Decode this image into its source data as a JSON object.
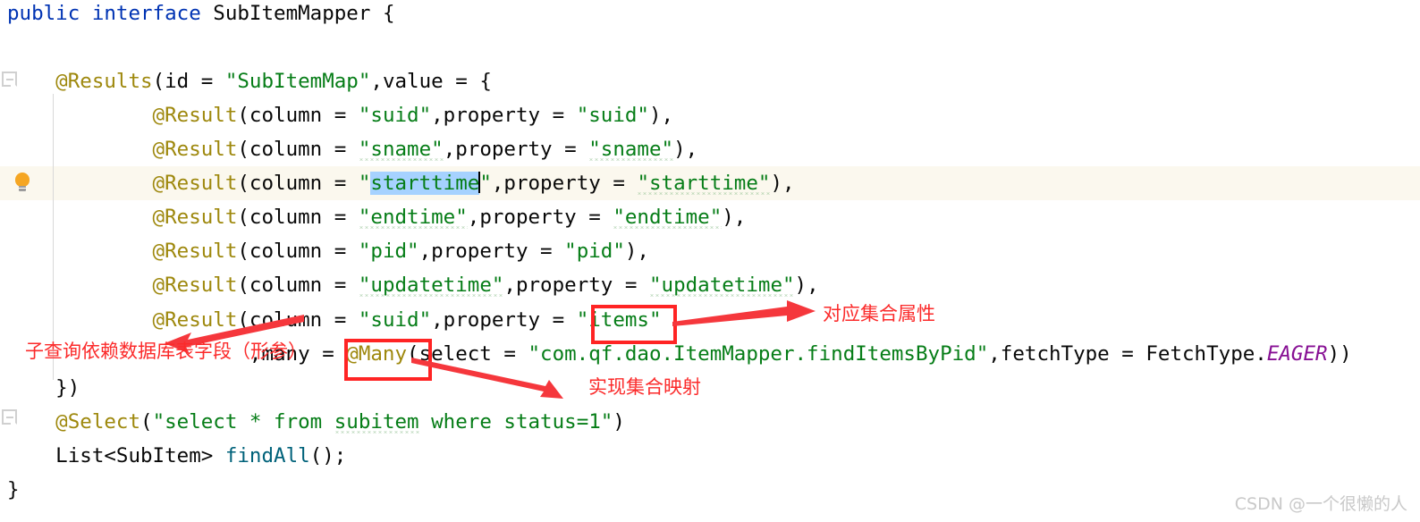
{
  "editor": {
    "language": "java",
    "background": "#ffffff",
    "current_line_highlight_color": "#fbf8ee",
    "selection_color": "#a6d2ff",
    "lines": [
      {
        "id": "line-1",
        "segments": [
          {
            "text": "public ",
            "kind": "keyword"
          },
          {
            "text": "interface ",
            "kind": "keyword"
          },
          {
            "text": "SubItemMapper {",
            "kind": "plain"
          }
        ]
      },
      {
        "id": "line-3",
        "segments": [
          {
            "text": "    @Results",
            "kind": "annotation"
          },
          {
            "text": "(id = ",
            "kind": "plain"
          },
          {
            "text": "\"SubItemMap\"",
            "kind": "string"
          },
          {
            "text": ",value = {",
            "kind": "plain"
          }
        ]
      },
      {
        "id": "line-4",
        "segments": [
          {
            "text": "            @Result",
            "kind": "annotation"
          },
          {
            "text": "(column = ",
            "kind": "plain"
          },
          {
            "text": "\"suid\"",
            "kind": "string"
          },
          {
            "text": ",property = ",
            "kind": "plain"
          },
          {
            "text": "\"suid\"",
            "kind": "string"
          },
          {
            "text": "),",
            "kind": "plain"
          }
        ]
      },
      {
        "id": "line-5",
        "segments": [
          {
            "text": "            @Result",
            "kind": "annotation"
          },
          {
            "text": "(column = ",
            "kind": "plain"
          },
          {
            "text": "\"sname\"",
            "kind": "string-squiggle"
          },
          {
            "text": ",property = ",
            "kind": "plain"
          },
          {
            "text": "\"sname\"",
            "kind": "string-squiggle"
          },
          {
            "text": "),",
            "kind": "plain"
          }
        ]
      },
      {
        "id": "line-6",
        "current": true,
        "segments": [
          {
            "text": "            @Result",
            "kind": "annotation"
          },
          {
            "text": "(column = ",
            "kind": "plain"
          },
          {
            "text": "\"",
            "kind": "string"
          },
          {
            "text": "starttime",
            "kind": "string-selected"
          },
          {
            "text": "\"",
            "kind": "string"
          },
          {
            "text": ",property = ",
            "kind": "plain"
          },
          {
            "text": "\"starttime\"",
            "kind": "string-squiggle"
          },
          {
            "text": "),",
            "kind": "plain"
          }
        ]
      },
      {
        "id": "line-7",
        "segments": [
          {
            "text": "            @Result",
            "kind": "annotation"
          },
          {
            "text": "(column = ",
            "kind": "plain"
          },
          {
            "text": "\"endtime\"",
            "kind": "string-squiggle"
          },
          {
            "text": ",property = ",
            "kind": "plain"
          },
          {
            "text": "\"endtime\"",
            "kind": "string-squiggle"
          },
          {
            "text": "),",
            "kind": "plain"
          }
        ]
      },
      {
        "id": "line-8",
        "segments": [
          {
            "text": "            @Result",
            "kind": "annotation"
          },
          {
            "text": "(column = ",
            "kind": "plain"
          },
          {
            "text": "\"pid\"",
            "kind": "string"
          },
          {
            "text": ",property = ",
            "kind": "plain"
          },
          {
            "text": "\"pid\"",
            "kind": "string"
          },
          {
            "text": "),",
            "kind": "plain"
          }
        ]
      },
      {
        "id": "line-9",
        "segments": [
          {
            "text": "            @Result",
            "kind": "annotation"
          },
          {
            "text": "(column = ",
            "kind": "plain"
          },
          {
            "text": "\"updatetime\"",
            "kind": "string-squiggle"
          },
          {
            "text": ",property = ",
            "kind": "plain"
          },
          {
            "text": "\"updatetime\"",
            "kind": "string-squiggle"
          },
          {
            "text": "),",
            "kind": "plain"
          }
        ]
      },
      {
        "id": "line-10",
        "segments": [
          {
            "text": "            @Result",
            "kind": "annotation"
          },
          {
            "text": "(column = ",
            "kind": "plain"
          },
          {
            "text": "\"suid\"",
            "kind": "string"
          },
          {
            "text": ",property = ",
            "kind": "plain"
          },
          {
            "text": "\"items\"",
            "kind": "string"
          }
        ]
      },
      {
        "id": "line-11",
        "segments": [
          {
            "text": "                    ,many = ",
            "kind": "plain"
          },
          {
            "text": "@Many",
            "kind": "annotation"
          },
          {
            "text": "(select = ",
            "kind": "plain"
          },
          {
            "text": "\"com.qf.dao.ItemMapper.findItemsByPid\"",
            "kind": "string"
          },
          {
            "text": ",fetchType = FetchType.",
            "kind": "plain"
          },
          {
            "text": "EAGER",
            "kind": "static-field"
          },
          {
            "text": "))",
            "kind": "plain"
          }
        ]
      },
      {
        "id": "line-12",
        "segments": [
          {
            "text": "    })",
            "kind": "plain"
          }
        ]
      },
      {
        "id": "line-13",
        "segments": [
          {
            "text": "    @Select",
            "kind": "annotation"
          },
          {
            "text": "(",
            "kind": "plain"
          },
          {
            "text": "\"select * from ",
            "kind": "string"
          },
          {
            "text": "subitem",
            "kind": "string-squiggle"
          },
          {
            "text": " where status=1\"",
            "kind": "string"
          },
          {
            "text": ")",
            "kind": "plain"
          }
        ]
      },
      {
        "id": "line-14",
        "segments": [
          {
            "text": "    List<SubItem> ",
            "kind": "plain"
          },
          {
            "text": "findAll",
            "kind": "method"
          },
          {
            "text": "();",
            "kind": "plain"
          }
        ]
      },
      {
        "id": "line-15",
        "segments": [
          {
            "text": "}",
            "kind": "plain"
          }
        ]
      }
    ]
  },
  "gutter": {
    "fold_marker_top_label": "collapse-region",
    "fold_marker_bottom_label": "collapse-region",
    "bulb_label": "show-intention-actions"
  },
  "annotations": {
    "items_note": "对应集合属性",
    "many_note": "实现集合映射",
    "column_note": "子查询依赖数据库表字段（形参）",
    "box_color": "#ff2424",
    "text_color": "#fb2a2a",
    "arrow_color": "#f5373c"
  },
  "watermark": {
    "text": "CSDN @一个很懒的人",
    "color": "#c9c9c9"
  }
}
